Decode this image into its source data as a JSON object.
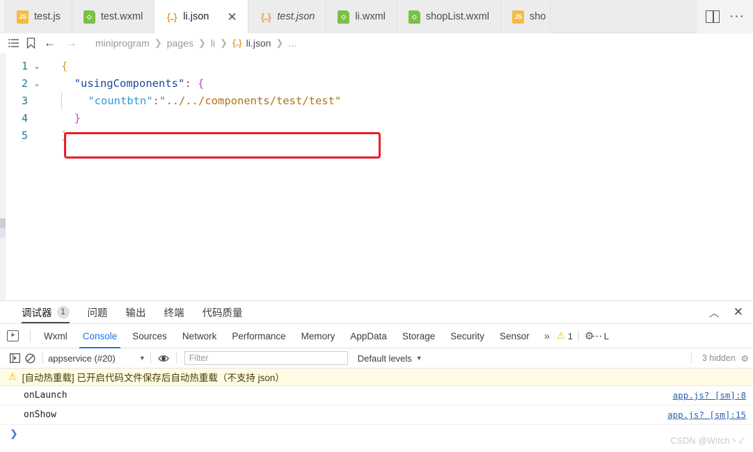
{
  "tabbar": {
    "tabs": [
      {
        "label": "test.js",
        "icon": "js-file-icon",
        "icon_text": "JS",
        "active": false,
        "italic": false,
        "closable": false
      },
      {
        "label": "test.wxml",
        "icon": "wxml-file-icon",
        "icon_text": "<>",
        "active": false,
        "italic": false,
        "closable": false
      },
      {
        "label": "li.json",
        "icon": "json-file-icon",
        "icon_text": "{..}",
        "active": true,
        "italic": false,
        "closable": true
      },
      {
        "label": "test.json",
        "icon": "json-file-icon",
        "icon_text": "{..}",
        "active": false,
        "italic": true,
        "closable": false
      },
      {
        "label": "li.wxml",
        "icon": "wxml-file-icon",
        "icon_text": "<>",
        "active": false,
        "italic": false,
        "closable": false
      },
      {
        "label": "shopList.wxml",
        "icon": "wxml-file-icon",
        "icon_text": "<>",
        "active": false,
        "italic": false,
        "closable": false
      },
      {
        "label": "sho",
        "icon": "js-file-icon",
        "icon_text": "JS",
        "active": false,
        "italic": false,
        "closable": false
      }
    ],
    "close_glyph": "✕",
    "split_editor_label": "split-editor",
    "more_actions_label": "···"
  },
  "breadcrumb": {
    "outline_icon": "list-icon",
    "bookmark_icon": "bookmark-icon",
    "back_glyph": "←",
    "forward_glyph": "→",
    "separator": "❯",
    "segments": [
      "miniprogram",
      "pages",
      "li"
    ],
    "file": "li.json",
    "file_icon_text": "{..}",
    "ellipsis": "..."
  },
  "editor": {
    "line_numbers": [
      "1",
      "2",
      "3",
      "4",
      "5"
    ],
    "fold_markers": [
      "⌄",
      "⌄",
      "",
      "",
      ""
    ],
    "lines": [
      {
        "n": 1,
        "tokens": [
          {
            "t": "{",
            "c": "br-y"
          }
        ]
      },
      {
        "n": 2,
        "tokens": [
          {
            "t": "  ",
            "c": ""
          },
          {
            "t": "\"usingComponents\"",
            "c": "k-key"
          },
          {
            "t": ":",
            "c": "k-colon"
          },
          {
            "t": " ",
            "c": ""
          },
          {
            "t": "{",
            "c": "br-p"
          }
        ]
      },
      {
        "n": 3,
        "tokens": [
          {
            "t": "    ",
            "c": ""
          },
          {
            "t": "\"countbtn\"",
            "c": "k-key2"
          },
          {
            "t": ":",
            "c": "k-colon"
          },
          {
            "t": "\"../../components/test/test\"",
            "c": "k-str"
          }
        ]
      },
      {
        "n": 4,
        "tokens": [
          {
            "t": "  ",
            "c": ""
          },
          {
            "t": "}",
            "c": "br-p"
          }
        ]
      },
      {
        "n": 5,
        "tokens": [
          {
            "t": "}",
            "c": "br-y"
          }
        ]
      }
    ],
    "annotation": {
      "shape": "rectangle",
      "color": "#ee1c25",
      "targets_line": 3
    }
  },
  "bottom_panel": {
    "tabs": [
      {
        "label": "调试器",
        "badge": "1",
        "active": true
      },
      {
        "label": "问题",
        "badge": "",
        "active": false
      },
      {
        "label": "输出",
        "badge": "",
        "active": false
      },
      {
        "label": "终端",
        "badge": "",
        "active": false
      },
      {
        "label": "代码质量",
        "badge": "",
        "active": false
      }
    ],
    "collapse_glyph": "︿",
    "close_glyph": "✕"
  },
  "devtools": {
    "inspect_icon": "inspect-element-icon",
    "tabs": [
      {
        "label": "Wxml",
        "active": false
      },
      {
        "label": "Console",
        "active": true
      },
      {
        "label": "Sources",
        "active": false
      },
      {
        "label": "Network",
        "active": false
      },
      {
        "label": "Performance",
        "active": false
      },
      {
        "label": "Memory",
        "active": false
      },
      {
        "label": "AppData",
        "active": false
      },
      {
        "label": "Storage",
        "active": false
      },
      {
        "label": "Security",
        "active": false
      },
      {
        "label": "Sensor",
        "active": false
      }
    ],
    "overflow_glyph": "»",
    "warning_glyph": "⚠",
    "warning_count": "1",
    "settings_icon": "gear-icon",
    "more_icon": "kebab-menu-icon",
    "edge_letter": "L"
  },
  "console_toolbar": {
    "sidebar_icon": "console-sidebar-icon",
    "clear_icon": "clear-console-icon",
    "context": "appservice (#20)",
    "context_caret": "▼",
    "eye_icon": "live-expression-icon",
    "filter_placeholder": "Filter",
    "filter_value": "",
    "levels_label": "Default levels",
    "levels_caret": "▼",
    "hidden_label": "3 hidden",
    "settings_glyph": "⚙"
  },
  "console": {
    "warning": {
      "icon": "warning-triangle-icon",
      "text": "[自动热重载] 已开启代码文件保存后自动热重载（不支持 json）"
    },
    "messages": [
      {
        "text": "onLaunch",
        "source": "app.js? [sm]:8"
      },
      {
        "text": "onShow",
        "source": "app.js? [sm]:15"
      }
    ],
    "prompt_glyph": "❯"
  },
  "watermark": {
    "text": "CSDN @Witch丶✓"
  },
  "colors": {
    "accent_blue": "#1a73e8",
    "annotation_red": "#ee1c25",
    "warning_bg": "#fffbe5",
    "warning_yellow": "#f5b400",
    "js_icon": "#f5bc42",
    "wxml_icon": "#7ac143",
    "json_icon": "#e8a33d",
    "linenum_blue": "#237893"
  }
}
